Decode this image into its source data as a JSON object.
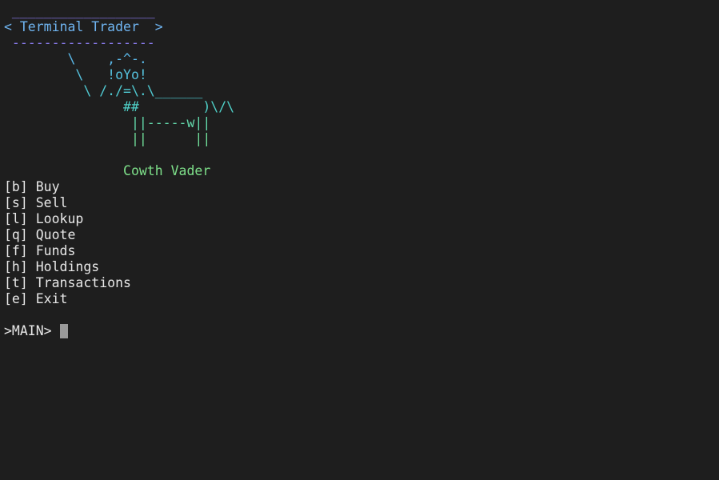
{
  "colors": {
    "background": "#1e1e1e",
    "text": "#e8e8e8",
    "banner_border": "#8a7cf0",
    "banner_title": "#6fb4f0",
    "cow_top": "#5ab8e8",
    "cow_mid": "#4fd0c8",
    "cow_bottom": "#7ee08a",
    "caption": "#7ee08a",
    "cursor": "#9a9a9a"
  },
  "banner": {
    "top_border": " __________________",
    "title_line": "< Terminal Trader  >",
    "bottom_border": " ------------------"
  },
  "ascii_art": {
    "lines": [
      "        \\    ,-^-.",
      "         \\   !oYo!",
      "          \\ /./=\\.\\______",
      "               ##        )\\/\\",
      "                ||-----w||",
      "                ||      ||"
    ]
  },
  "caption": "               Cowth Vader",
  "menu": {
    "items": [
      {
        "key": "[b]",
        "label": "Buy"
      },
      {
        "key": "[s]",
        "label": "Sell"
      },
      {
        "key": "[l]",
        "label": "Lookup"
      },
      {
        "key": "[q]",
        "label": "Quote"
      },
      {
        "key": "[f]",
        "label": "Funds"
      },
      {
        "key": "[h]",
        "label": "Holdings"
      },
      {
        "key": "[t]",
        "label": "Transactions"
      },
      {
        "key": "[e]",
        "label": "Exit"
      }
    ]
  },
  "prompt": {
    "text": ">MAIN> "
  }
}
